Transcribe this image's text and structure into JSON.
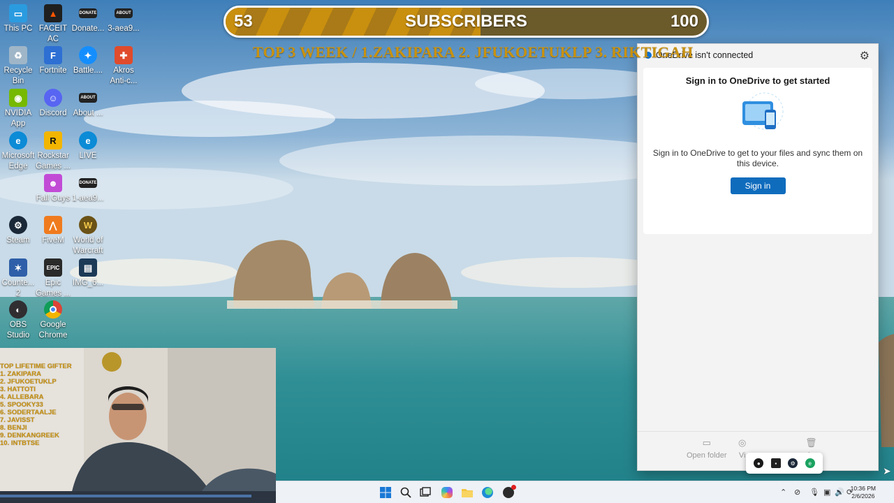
{
  "desktop": {
    "icons": [
      {
        "label": "This PC",
        "icon": "monitor-icon",
        "color": "#2b9be0"
      },
      {
        "label": "FACEIT AC",
        "icon": "faceit-icon",
        "color": "#1f1f1f"
      },
      {
        "label": "Donate...",
        "icon": "donate-icon",
        "color": "#222222"
      },
      {
        "label": "3-aea9...",
        "icon": "image-file-icon",
        "color": "#222222"
      },
      {
        "label": "Recycle Bin",
        "icon": "recycle-bin-icon",
        "color": "#9fb6c8"
      },
      {
        "label": "Fortnite",
        "icon": "fortnite-icon",
        "color": "#2d6fd3"
      },
      {
        "label": "Battle....",
        "icon": "battlenet-icon",
        "color": "#148eff"
      },
      {
        "label": "Akros Anti-c...",
        "icon": "akros-icon",
        "color": "#e04b2c"
      },
      {
        "label": "NVIDIA App",
        "icon": "nvidia-icon",
        "color": "#76b900"
      },
      {
        "label": "Discord",
        "icon": "discord-icon",
        "color": "#5865f2"
      },
      {
        "label": "About ...",
        "icon": "about-file-icon",
        "color": "#222222"
      },
      {
        "label": "Microsoft Edge",
        "icon": "edge-icon",
        "color": "#0c8bd6"
      },
      {
        "label": "Rockstar Games ...",
        "icon": "rockstar-icon",
        "color": "#f2b500"
      },
      {
        "label": "LIVE",
        "icon": "live-edge-icon",
        "color": "#0c8bd6"
      },
      {
        "label": "Fall Guys",
        "icon": "fall-guys-icon",
        "color": "#c24bd6"
      },
      {
        "label": "1-aea9...",
        "icon": "image-file-icon",
        "color": "#222222"
      },
      {
        "label": "Steam",
        "icon": "steam-icon",
        "color": "#1b2838"
      },
      {
        "label": "FiveM",
        "icon": "fivem-icon",
        "color": "#f07b1e"
      },
      {
        "label": "World of Warcraft",
        "icon": "wow-icon",
        "color": "#6b5216"
      },
      {
        "label": "Counte... 2",
        "icon": "cs2-icon",
        "color": "#2e5fa8"
      },
      {
        "label": "Epic Games ...",
        "icon": "epic-icon",
        "color": "#2a2a2a"
      },
      {
        "label": "IMG_6...",
        "icon": "image-file-icon",
        "color": "#1c3a57"
      },
      {
        "label": "OBS Studio",
        "icon": "obs-icon",
        "color": "#302e31"
      },
      {
        "label": "Google Chrome",
        "icon": "chrome-icon",
        "color": "#ffffff"
      }
    ]
  },
  "overlay": {
    "sub_current": "53",
    "sub_label": "SUBSCRIBERS",
    "sub_goal": "100",
    "sub_progress": 0.53,
    "top3": "TOP 3 WEEK / 1.ZAKIPARA 2. JFUKOETUKLP  3.  RIKTIGAH",
    "gifters_title": "TOP LIFETIME GIFTER",
    "gifters": [
      "1. ZAKIPARA",
      "2. JFUKOETUKLP",
      "3. HATTOTI",
      "4. ALLEBARA",
      "5. SPOOKY33",
      "6. SODERTAALJE",
      "7. JAVISST",
      "8. BENJI",
      "9. DENKANGREEK",
      "10. INTBTSE"
    ]
  },
  "onedrive": {
    "status": "OneDrive isn't connected",
    "heading": "Sign in to OneDrive to get started",
    "body": "Sign in to OneDrive to get to your files and sync them on this device.",
    "signin_label": "Sign in",
    "footer": {
      "open_folder": "Open folder",
      "view_online": "Vi",
      "recycle_bin": "in"
    }
  },
  "taskbar": {
    "time": "10:36 PM",
    "date": "2/6/2026"
  },
  "colors": {
    "accent": "#0f6cbd",
    "overlay_gold": "#c9920f"
  }
}
